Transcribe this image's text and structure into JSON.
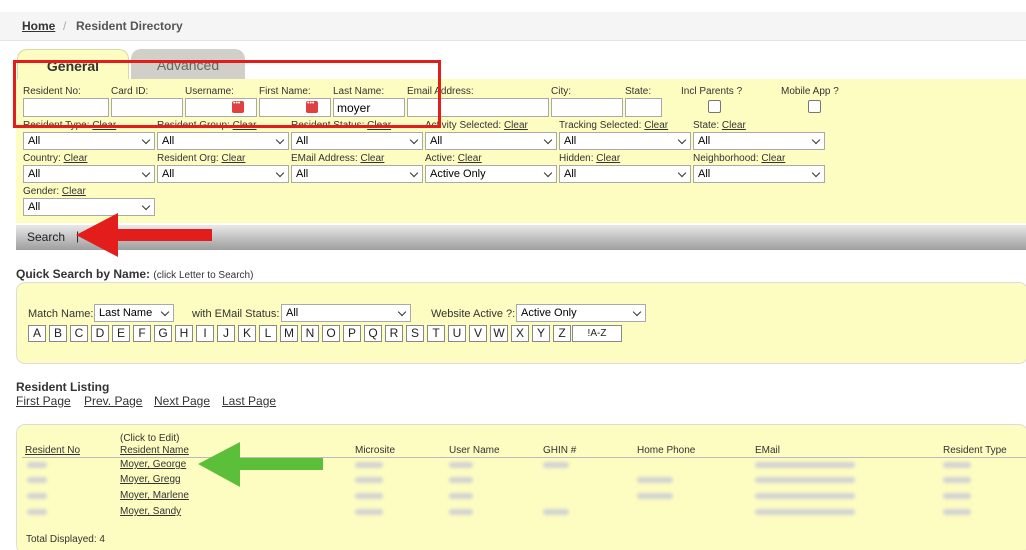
{
  "breadcrumb": {
    "home": "Home",
    "separator": "/",
    "current": "Resident Directory"
  },
  "tabs": [
    {
      "label": "General"
    },
    {
      "label": "Advanced"
    }
  ],
  "filters": {
    "resident_no": {
      "label": "Resident No:",
      "value": ""
    },
    "card_id": {
      "label": "Card ID:",
      "value": ""
    },
    "username": {
      "label": "Username:",
      "value": ""
    },
    "first_name": {
      "label": "First Name:",
      "value": ""
    },
    "last_name": {
      "label": "Last Name:",
      "value": "moyer"
    },
    "email_address": {
      "label": "Email Address:",
      "value": ""
    },
    "city": {
      "label": "City:",
      "value": ""
    },
    "state_text": {
      "label": "State:",
      "value": ""
    },
    "incl_parents": {
      "label": "Incl Parents ?"
    },
    "mobile_app": {
      "label": "Mobile App ?"
    },
    "clear_label": "Clear",
    "selects": [
      {
        "label": "Resident Type:",
        "value": "All"
      },
      {
        "label": "Resident Group:",
        "value": "All"
      },
      {
        "label": "Resident Status:",
        "value": "All"
      },
      {
        "label": "Activity Selected:",
        "value": "All"
      },
      {
        "label": "Tracking Selected:",
        "value": "All"
      },
      {
        "label": "State:",
        "value": "All"
      },
      {
        "label": "Country:",
        "value": "All"
      },
      {
        "label": "Resident Org:",
        "value": "All"
      },
      {
        "label": "EMail Address:",
        "value": "All"
      },
      {
        "label": "Active:",
        "value": "Active Only"
      },
      {
        "label": "Hidden:",
        "value": "All"
      },
      {
        "label": "Neighborhood:",
        "value": "All"
      },
      {
        "label": "Gender:",
        "value": "All"
      }
    ]
  },
  "search_bar": {
    "search_label": "Search",
    "separator": "|"
  },
  "quick_search": {
    "title": "Quick Search by Name:",
    "subtitle": "(click Letter to Search)",
    "match_name_label": "Match Name:",
    "match_name_value": "Last Name",
    "email_status_label": "with EMail Status:",
    "email_status_value": "All",
    "website_active_label": "Website Active ?:",
    "website_active_value": "Active Only",
    "letters": [
      "A",
      "B",
      "C",
      "D",
      "E",
      "F",
      "G",
      "H",
      "I",
      "J",
      "K",
      "L",
      "M",
      "N",
      "O",
      "P",
      "Q",
      "R",
      "S",
      "T",
      "U",
      "V",
      "W",
      "X",
      "Y",
      "Z"
    ],
    "all_label": "!A-Z"
  },
  "listing": {
    "title": "Resident Listing",
    "pager": [
      "First Page",
      "Prev. Page",
      "Next Page",
      "Last Page"
    ],
    "click_to_edit": "(Click to Edit)",
    "columns": {
      "resident_no": "Resident No",
      "resident_name": "Resident Name",
      "microsite": "Microsite",
      "user_name": "User Name",
      "ghin": "GHIN #",
      "home_phone": "Home Phone",
      "email": "EMail",
      "resident_type": "Resident Type"
    },
    "rows": [
      {
        "name": "Moyer, George"
      },
      {
        "name": "Moyer, Gregg"
      },
      {
        "name": "Moyer, Marlene"
      },
      {
        "name": "Moyer, Sandy"
      }
    ],
    "total": "Total Displayed: 4"
  },
  "annotations": {
    "highlight_color": "#e31c1c",
    "arrow_red": "#e31c1c",
    "arrow_green": "#5cbf3a"
  }
}
